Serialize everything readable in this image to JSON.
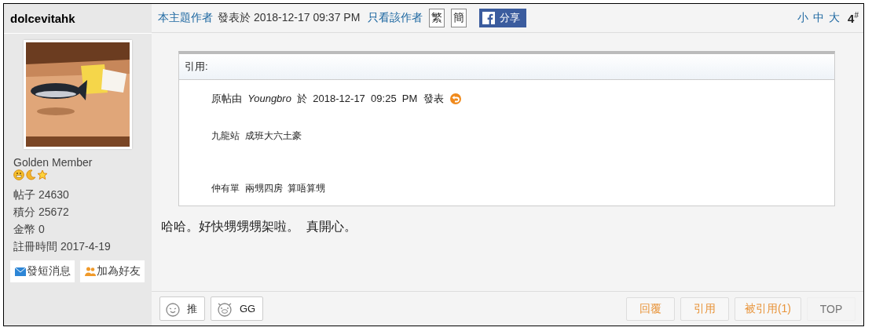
{
  "author": {
    "name": "dolcevitahk",
    "rank": "Golden Member",
    "stats": [
      {
        "label": "帖子",
        "value": "24630"
      },
      {
        "label": "積分",
        "value": "25672"
      },
      {
        "label": "金幣",
        "value": "0"
      },
      {
        "label": "註冊時間",
        "value": "2017-4-19"
      }
    ],
    "actions": [
      {
        "kind": "message",
        "label": "發短消息"
      },
      {
        "kind": "friend",
        "label": "加為好友"
      }
    ]
  },
  "post_header": {
    "author_link": "本主題作者",
    "posted": "發表於 2018-12-17 09:37 PM",
    "only_author": "只看該作者",
    "script_buttons": [
      "繁",
      "簡"
    ],
    "share": "分享",
    "font_sizes": [
      "小",
      "中",
      "大"
    ],
    "floor": "4$^{#}$"
  },
  "quote": {
    "title": "引用:",
    "source": "原帖由  *Youngbro*  於  2018-12-17  09:25  PM  發表",
    "lines": [
      "九龍站  成班大六土豪",
      "仲有單  兩甥四房  算唔算甥"
    ]
  },
  "message": "哈哈。好快甥甥甥架啦。  真開心。",
  "reactions": [
    {
      "kind": "face",
      "label": "推"
    },
    {
      "kind": "pig",
      "label": "GG"
    }
  ],
  "footer_buttons": [
    {
      "label": "回覆",
      "kind": "accent"
    },
    {
      "label": "引用",
      "kind": "accent"
    },
    {
      "label": "被引用(1)",
      "kind": "accent"
    },
    {
      "label": "TOP",
      "kind": "plain"
    }
  ]
}
